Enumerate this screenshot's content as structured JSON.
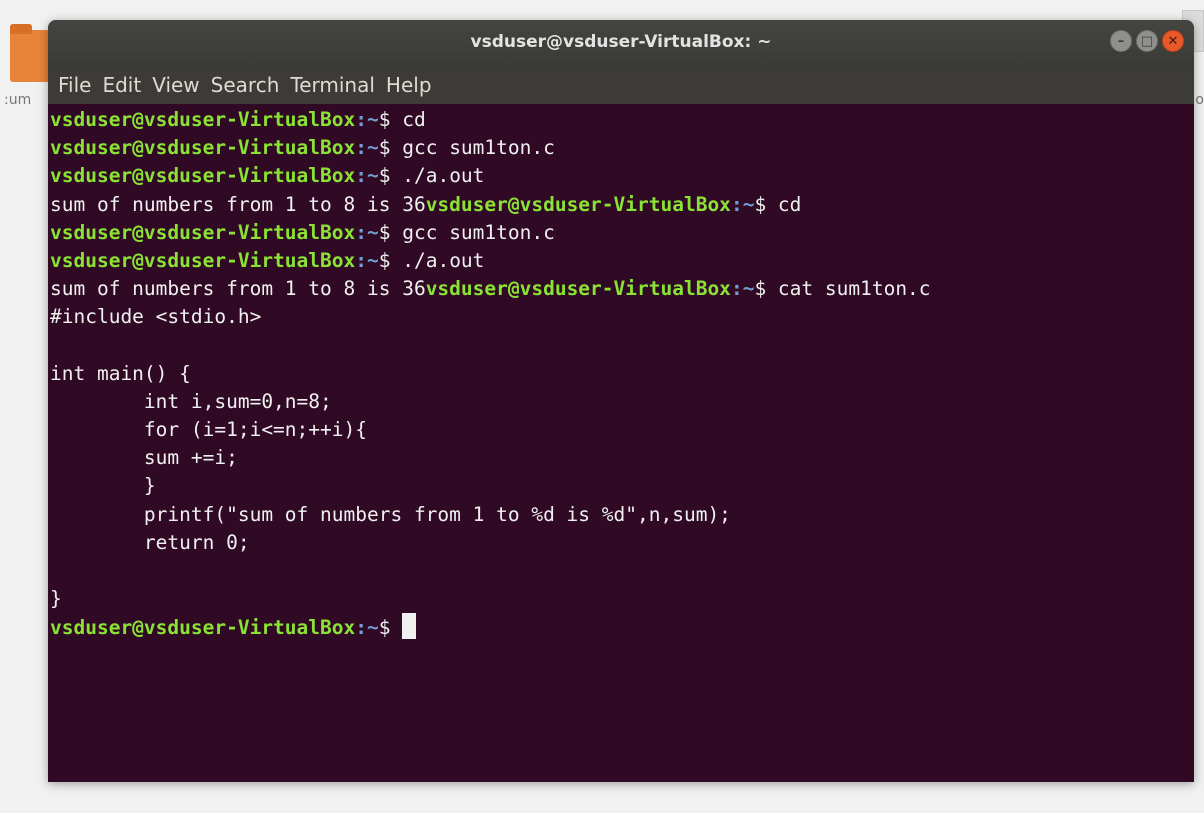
{
  "window": {
    "title": "vsduser@vsduser-VirtualBox: ~"
  },
  "menu": [
    "File",
    "Edit",
    "View",
    "Search",
    "Terminal",
    "Help"
  ],
  "desktop": {
    "left_label": ":um",
    "right_label": "o"
  },
  "prompt": {
    "user_host": "vsduser@vsduser-VirtualBox",
    "sep": ":",
    "path": "~",
    "symbol": "$ "
  },
  "lines": [
    {
      "type": "prompt",
      "cmd": "cd"
    },
    {
      "type": "prompt",
      "cmd": "gcc sum1ton.c"
    },
    {
      "type": "prompt",
      "cmd": "./a.out"
    },
    {
      "type": "output_prompt",
      "output": "sum of numbers from 1 to 8 is 36",
      "cmd": "cd"
    },
    {
      "type": "prompt",
      "cmd": "gcc sum1ton.c"
    },
    {
      "type": "prompt",
      "cmd": "./a.out"
    },
    {
      "type": "output_prompt",
      "output": "sum of numbers from 1 to 8 is 36",
      "cmd": "cat sum1ton.c"
    },
    {
      "type": "text",
      "text": "#include <stdio.h>"
    },
    {
      "type": "text",
      "text": ""
    },
    {
      "type": "text",
      "text": "int main() {"
    },
    {
      "type": "text",
      "text": "        int i,sum=0,n=8;"
    },
    {
      "type": "text",
      "text": "        for (i=1;i<=n;++i){"
    },
    {
      "type": "text",
      "text": "        sum +=i;"
    },
    {
      "type": "text",
      "text": "        }"
    },
    {
      "type": "text",
      "text": "        printf(\"sum of numbers from 1 to %d is %d\",n,sum);"
    },
    {
      "type": "text",
      "text": "        return 0;"
    },
    {
      "type": "text",
      "text": ""
    },
    {
      "type": "text",
      "text": "}"
    },
    {
      "type": "prompt_cursor",
      "cmd": ""
    }
  ],
  "colors": {
    "terminal_bg": "#300a24",
    "prompt_user": "#8ae234",
    "prompt_path": "#729fcf",
    "text": "#f0f0f0"
  }
}
